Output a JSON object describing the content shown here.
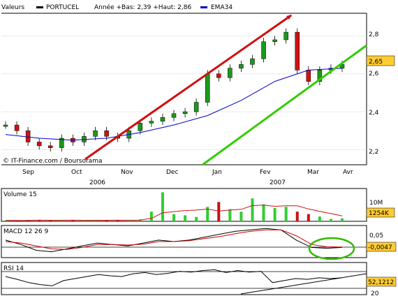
{
  "header": {
    "valeurs_label": "Valeurs",
    "series_name": "PORTUCEL",
    "range_text": "Année +Bas: 2,39 +Haut: 2,86",
    "ema_label": "EMA34"
  },
  "colors": {
    "price_up": "#1a9a1a",
    "price_down": "#d01010",
    "ema": "#0000cc",
    "trend_resistance": "#d01010",
    "trend_support": "#33cc00",
    "volume_up": "#33cc33",
    "volume_down": "#cc1111",
    "macd": "#000000",
    "signal": "#cc0000",
    "highlight_ellipse": "#33bb00",
    "value_box_bg": "#ffcc33"
  },
  "copyright": "© IT-Finance.com / Boursorama",
  "price_panel": {
    "y_ticks": [
      "2,8",
      "2,6",
      "2,4",
      "2,2"
    ],
    "last_value": "2,65",
    "months": [
      "Sep",
      "Oct",
      "Nov",
      "Dec",
      "Jan",
      "Fev",
      "Mar",
      "Avr"
    ],
    "years": [
      "2006",
      "2007"
    ]
  },
  "volume_panel": {
    "label": "Volume 15",
    "y_tick": "10M",
    "last_value": "1254K"
  },
  "macd_panel": {
    "label": "MACD 12 26 9",
    "y_tick": "0,05",
    "last_value": "-0,0047"
  },
  "rsi_panel": {
    "label": "RSI 14",
    "y_tick": "20",
    "last_value": "52,1212"
  },
  "chart_data": {
    "type": "line",
    "series": [
      {
        "name": "PORTUCEL",
        "x": [
          "2006-08-25",
          "2006-09-01",
          "2006-09-08",
          "2006-09-15",
          "2006-09-22",
          "2006-09-29",
          "2006-10-06",
          "2006-10-13",
          "2006-10-20",
          "2006-10-27",
          "2006-11-03",
          "2006-11-10",
          "2006-11-17",
          "2006-11-24",
          "2006-12-01",
          "2006-12-08",
          "2006-12-15",
          "2006-12-22",
          "2006-12-29",
          "2007-01-05",
          "2007-01-12",
          "2007-01-19",
          "2007-01-26",
          "2007-02-02",
          "2007-02-09",
          "2007-02-16",
          "2007-02-23",
          "2007-03-02",
          "2007-03-09",
          "2007-03-16",
          "2007-03-23"
        ],
        "values": [
          2.33,
          2.3,
          2.24,
          2.22,
          2.21,
          2.26,
          2.24,
          2.27,
          2.3,
          2.27,
          2.26,
          2.3,
          2.34,
          2.35,
          2.37,
          2.39,
          2.4,
          2.45,
          2.6,
          2.58,
          2.63,
          2.65,
          2.68,
          2.77,
          2.78,
          2.82,
          2.62,
          2.56,
          2.62,
          2.63,
          2.65
        ]
      },
      {
        "name": "EMA34",
        "x": [
          "2006-08-25",
          "2006-09-15",
          "2006-10-06",
          "2006-10-27",
          "2006-11-17",
          "2006-12-08",
          "2006-12-29",
          "2007-01-19",
          "2007-02-09",
          "2007-03-02",
          "2007-03-23"
        ],
        "values": [
          2.28,
          2.26,
          2.25,
          2.26,
          2.29,
          2.33,
          2.38,
          2.46,
          2.56,
          2.62,
          2.63
        ]
      }
    ],
    "ylim": [
      2.12,
      2.92
    ],
    "volume": {
      "unit": "M",
      "ylim": [
        0,
        13
      ],
      "values": [
        0.4,
        0.3,
        0.5,
        0.6,
        0.3,
        0.4,
        0.5,
        0.3,
        0.6,
        0.4,
        0.5,
        0.3,
        0.8,
        4.0,
        12.0,
        3.0,
        2.5,
        1.8,
        6.0,
        8.0,
        5.0,
        4.0,
        9.5,
        7.0,
        5.5,
        6.0,
        4.0,
        3.0,
        2.0,
        1.0,
        1.25
      ]
    },
    "macd": {
      "ylim": [
        -0.04,
        0.07
      ],
      "macd": [
        0.02,
        0.005,
        -0.015,
        -0.02,
        -0.01,
        0.0,
        0.01,
        0.005,
        0.0,
        0.01,
        0.02,
        0.015,
        0.02,
        0.03,
        0.04,
        0.05,
        0.055,
        0.06,
        0.055,
        0.02,
        -0.005,
        -0.008,
        -0.005
      ],
      "signal": [
        0.015,
        0.01,
        0.0,
        -0.01,
        -0.012,
        -0.005,
        0.005,
        0.005,
        0.003,
        0.006,
        0.015,
        0.015,
        0.018,
        0.025,
        0.032,
        0.042,
        0.05,
        0.055,
        0.055,
        0.035,
        0.005,
        -0.003,
        -0.004
      ]
    },
    "rsi": {
      "ylim": [
        10,
        90
      ],
      "values": [
        55,
        48,
        40,
        35,
        32,
        45,
        50,
        55,
        60,
        57,
        55,
        62,
        65,
        60,
        63,
        68,
        66,
        70,
        72,
        65,
        70,
        66,
        68,
        40,
        45,
        50,
        48,
        52,
        50,
        52
      ]
    }
  }
}
